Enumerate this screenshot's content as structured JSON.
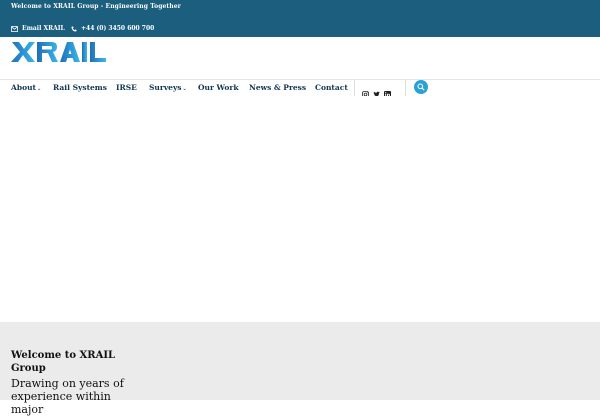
{
  "topbar": {
    "welcome_text": "Welcome to XRAIL Group - Engineering Together",
    "email_label": "Email XRAIL",
    "phone_label": "+44 (0) 3450 600 700"
  },
  "logo": {
    "text": "XRAIL",
    "alt": "XRAIL"
  },
  "nav": {
    "items": [
      {
        "label": "About",
        "dropdown": true
      },
      {
        "label": "Rail Systems",
        "dropdown": false
      },
      {
        "label": "IRSE",
        "dropdown": false
      },
      {
        "label": "Surveys",
        "dropdown": true
      },
      {
        "label": "Our Work",
        "dropdown": false
      },
      {
        "label": "News & Press",
        "dropdown": false
      },
      {
        "label": "Contact",
        "dropdown": false
      }
    ],
    "social_icons": [
      "instagram-icon",
      "twitter-icon",
      "linkedin-icon"
    ],
    "search_icon": "search-icon"
  },
  "intro": {
    "title": "Welcome to XRAIL Group",
    "body": "Drawing on years of experience within major"
  },
  "colors": {
    "topbar_bg": "#1b5e7e",
    "accent": "#2aa1d6",
    "nav_text": "#0f3550",
    "section_bg": "#ebebeb"
  }
}
